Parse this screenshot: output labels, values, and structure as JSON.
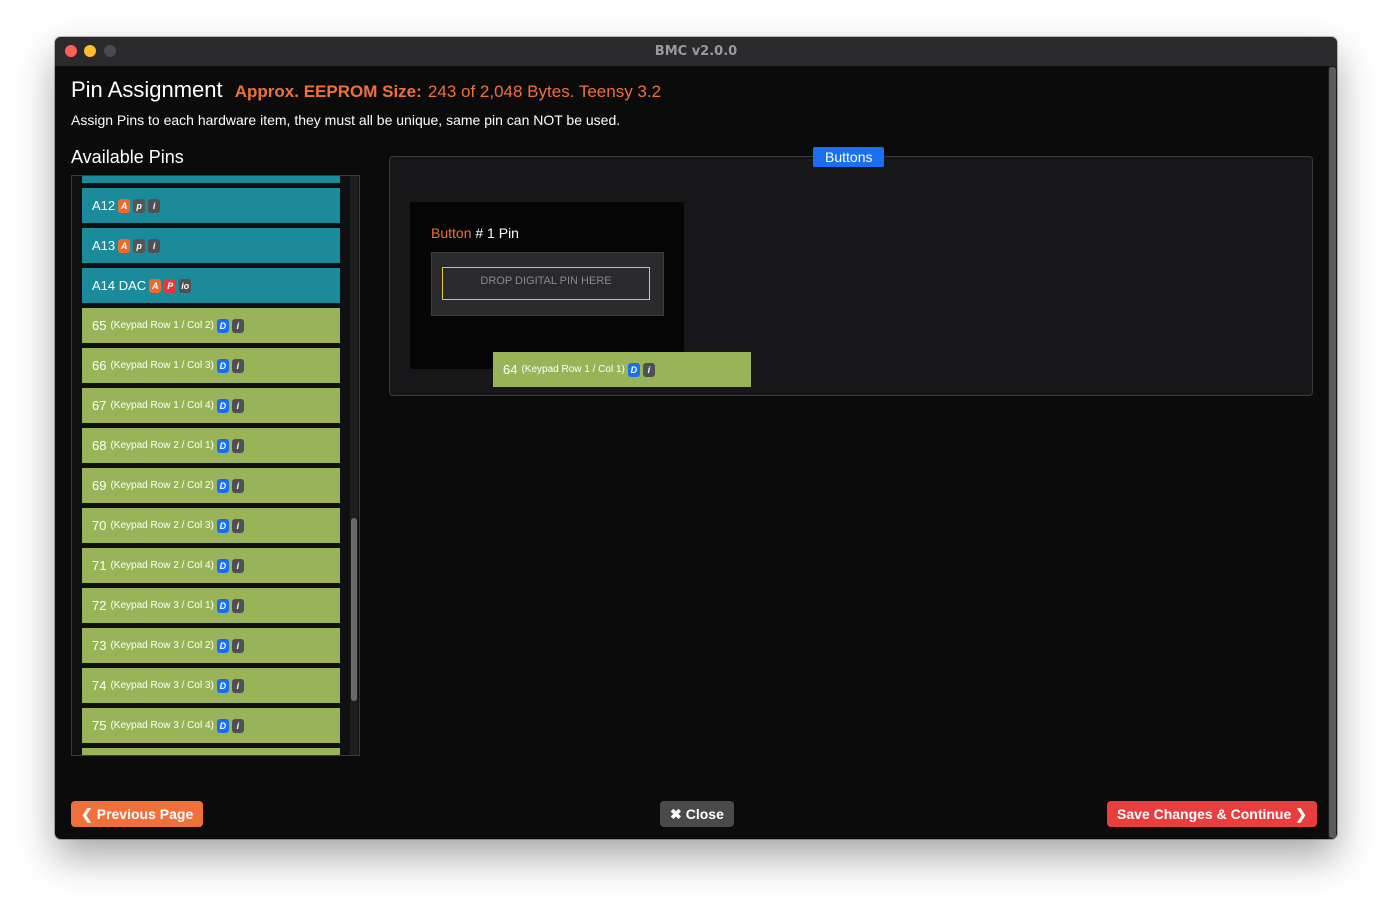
{
  "window": {
    "title": "BMC v2.0.0"
  },
  "header": {
    "title": "Pin Assignment",
    "eeprom_label": "Approx. EEPROM Size:",
    "eeprom_value": "243 of 2,048 Bytes. Teensy 3.2",
    "subtitle": "Assign Pins to each hardware item, they must all be unique, same pin can NOT be used."
  },
  "available_pins": {
    "title": "Available Pins",
    "items": [
      {
        "label": "A12",
        "sub": "",
        "badges": [
          "A",
          "p",
          "i"
        ],
        "color": "teal"
      },
      {
        "label": "A13",
        "sub": "",
        "badges": [
          "A",
          "p",
          "i"
        ],
        "color": "teal"
      },
      {
        "label": "A14 DAC",
        "sub": "",
        "badges": [
          "A",
          "P",
          "io"
        ],
        "color": "teal"
      },
      {
        "label": "65",
        "sub": "(Keypad Row 1 / Col 2)",
        "badges": [
          "D",
          "i"
        ],
        "color": "green"
      },
      {
        "label": "66",
        "sub": "(Keypad Row 1 / Col 3)",
        "badges": [
          "D",
          "i"
        ],
        "color": "green"
      },
      {
        "label": "67",
        "sub": "(Keypad Row 1 / Col 4)",
        "badges": [
          "D",
          "i"
        ],
        "color": "green"
      },
      {
        "label": "68",
        "sub": "(Keypad Row 2 / Col 1)",
        "badges": [
          "D",
          "i"
        ],
        "color": "green"
      },
      {
        "label": "69",
        "sub": "(Keypad Row 2 / Col 2)",
        "badges": [
          "D",
          "i"
        ],
        "color": "green"
      },
      {
        "label": "70",
        "sub": "(Keypad Row 2 / Col 3)",
        "badges": [
          "D",
          "i"
        ],
        "color": "green"
      },
      {
        "label": "71",
        "sub": "(Keypad Row 2 / Col 4)",
        "badges": [
          "D",
          "i"
        ],
        "color": "green"
      },
      {
        "label": "72",
        "sub": "(Keypad Row 3 / Col 1)",
        "badges": [
          "D",
          "i"
        ],
        "color": "green"
      },
      {
        "label": "73",
        "sub": "(Keypad Row 3 / Col 2)",
        "badges": [
          "D",
          "i"
        ],
        "color": "green"
      },
      {
        "label": "74",
        "sub": "(Keypad Row 3 / Col 3)",
        "badges": [
          "D",
          "i"
        ],
        "color": "green"
      },
      {
        "label": "75",
        "sub": "(Keypad Row 3 / Col 4)",
        "badges": [
          "D",
          "i"
        ],
        "color": "green"
      }
    ]
  },
  "buttons_section": {
    "legend": "Buttons",
    "card": {
      "title_prefix": "Button",
      "title_suffix": "# 1 Pin",
      "drop_placeholder": "DROP DIGITAL PIN HERE"
    },
    "dragged_pin": {
      "label": "64",
      "sub": "(Keypad Row 1 / Col 1)",
      "badges": [
        "D",
        "i"
      ]
    }
  },
  "footer": {
    "prev_label": "Previous Page",
    "close_label": "Close",
    "save_label": "Save Changes & Continue"
  },
  "colors": {
    "accent_orange": "#f0703a",
    "teal_pin": "#1b8a9a",
    "green_pin": "#99b458",
    "blue": "#1a6ff0",
    "save_red": "#e83e3e"
  }
}
